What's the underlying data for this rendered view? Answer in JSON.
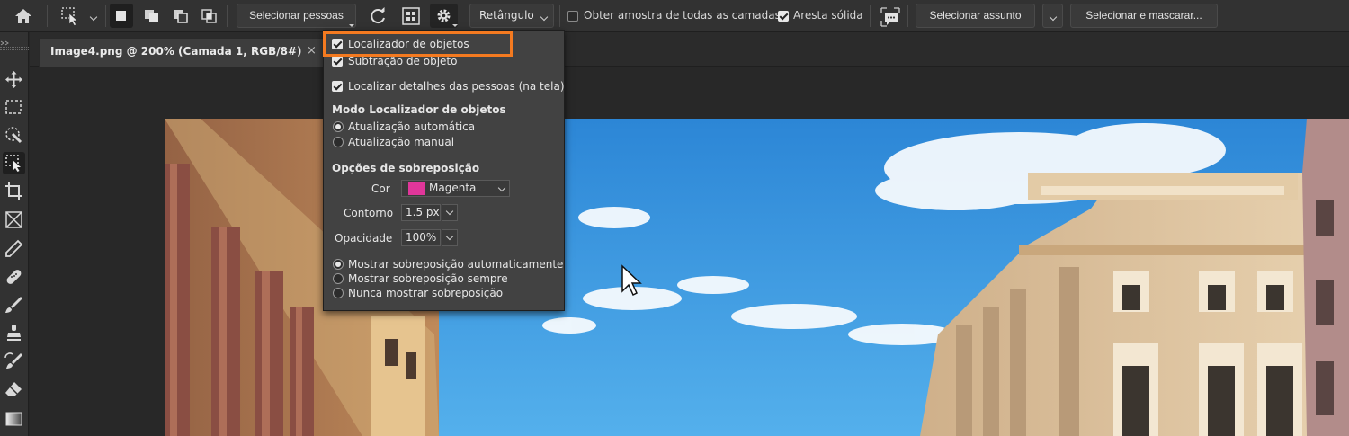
{
  "options_bar": {
    "select_people_label": "Selecionar pessoas",
    "mode_dropdown": "Retângulo",
    "sample_all_layers": {
      "label": "Obter amostra de todas as camadas",
      "checked": false
    },
    "hard_edge": {
      "label": "Aresta sólida",
      "checked": true
    },
    "select_subject_label": "Selecionar assunto",
    "select_and_mask_label": "Selecionar e mascarar..."
  },
  "document_tab": {
    "title": "Image4.png @ 200% (Camada 1, RGB/8#)",
    "close_glyph": "×"
  },
  "popup": {
    "object_finder": {
      "label": "Localizador de objetos",
      "checked": true
    },
    "object_subtraction": {
      "label": "Subtração de objeto",
      "checked": true
    },
    "find_people_details": {
      "label": "Localizar detalhes das pessoas (na tela)",
      "checked": true
    },
    "finder_mode_heading": "Modo Localizador de objetos",
    "auto_refresh": {
      "label": "Atualização automática",
      "selected": true
    },
    "manual_refresh": {
      "label": "Atualização manual",
      "selected": false
    },
    "overlay_options_heading": "Opções de sobreposição",
    "color_label": "Cor",
    "color_value": "Magenta",
    "color_swatch": "#e0369a",
    "outline_label": "Contorno",
    "outline_value": "1.5 px",
    "opacity_label": "Opacidade",
    "opacity_value": "100%",
    "show_auto": {
      "label": "Mostrar sobreposição automaticamente",
      "selected": true
    },
    "show_always": {
      "label": "Mostrar sobreposição sempre",
      "selected": false
    },
    "never_show": {
      "label": "Nunca mostrar sobreposição",
      "selected": false
    }
  },
  "colors": {
    "highlight": "#f47a20",
    "ui_bg": "#323232",
    "sky": "#2f8fd8"
  },
  "tools": [
    "home-icon",
    "object-selection-icon",
    "move-icon",
    "marquee-icon",
    "lasso-icon",
    "object-select-tool-icon",
    "crop-icon",
    "frame-icon",
    "eyedropper-icon",
    "healing-icon",
    "brush-icon",
    "stamp-icon",
    "history-brush-icon",
    "eraser-icon",
    "gradient-icon"
  ]
}
